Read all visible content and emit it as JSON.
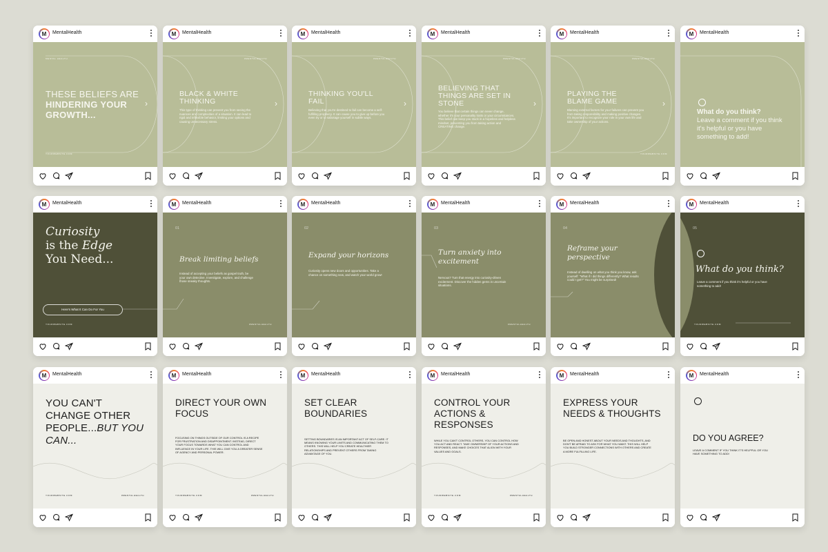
{
  "account": {
    "initial": "M",
    "handle": "MentalHealth"
  },
  "row1": [
    {
      "label": "MENTAL HEALTH",
      "title_a": "THESE BELIEFS ARE ",
      "title_b": "HINDERING YOUR GROWTH...",
      "footer": "YOURWEBSITE.COM"
    },
    {
      "label": "#MENTALHEALTH",
      "title": "BLACK & WHITE THINKING",
      "body": "This type of thinking can prevent you from seeing the nuances and complexities of a situation. It can lead to rigid and inflexible behavior, limiting your options and causing unnecessary stress."
    },
    {
      "label": "#MENTALHEALTH",
      "title": "THINKING YOU'LL FAIL",
      "body": "Believing that you're destined to fail can become a self-fulfilling prophecy. It can cause you to give up before you even try or to sabotage yourself in subtle ways."
    },
    {
      "label": "#MENTALHEALTH",
      "title": "BELIEVING THAT THINGS ARE SET IN STONE",
      "body": "You believe that certain things can never change, whether it's your personality traits or your circumstances. This belief can keep you stuck in a hopeless and helpless mindset, preventing you from taking action and CREATING change."
    },
    {
      "label": "#MENTALHEALTH",
      "title": "PLAYING THE BLAME GAME",
      "body": "Blaming external factors for your failures can prevent you from taking responsibility and making positive changes. It's important to recognize your role in your own life and take ownership of your actions.",
      "footer": "YOURWEBSITE.COM"
    },
    {
      "title": "What do you think?",
      "body": "Leave a comment if you think it's helpful or you have something to add!"
    }
  ],
  "row2": [
    {
      "title_a": "Curiosity",
      "title_b": "is the ",
      "title_c": "Edge",
      "title_d": "You Need...",
      "button": "Here's What It Can Do For You",
      "footer": "YOURWEBSITE.COM"
    },
    {
      "num": "01",
      "title": "Break limiting beliefs",
      "body": "Instead of accepting your beliefs as gospel truth, be your own detective. Investigate, explore, and challenge those sneaky thoughts.",
      "footer": "#MENTALHEALTH"
    },
    {
      "num": "02",
      "title": "Expand your horizons",
      "body": "Curiosity opens new doors and opportunities. Take a chance on something new, and watch your world grow!"
    },
    {
      "num": "03",
      "title": "Turn anxiety into excitement",
      "body": "Nervous? Turn that energy into curiosity-driven excitement. Discover the hidden gems in uncertain situations.",
      "footer": "#MENTALHEALTH"
    },
    {
      "num": "04",
      "title": "Reframe your perspective",
      "body": "Instead of dwelling on what you think you know, ask yourself: \"What if I did things differently? What results could I get?\" You might be surprised!"
    },
    {
      "num": "05",
      "title": "What do you think?",
      "body": "Leave a comment if you think it's helpful or you have something to add!",
      "footer": "YOURWEBSITE.COM"
    }
  ],
  "row3": [
    {
      "title_a": "YOU CAN'T CHANGE OTHER PEOPLE...",
      "title_b": "BUT YOU CAN...",
      "footer_l": "YOURWEBSITE.COM",
      "footer_r": "#MENTALHEALTH"
    },
    {
      "title": "DIRECT YOUR OWN FOCUS",
      "body": "FOCUSING ON THINGS OUTSIDE OF OUR CONTROL IS A RECIPE FOR FRUSTRATION AND DISAPPOINTMENT. INSTEAD, DIRECT YOUR FOCUS TOWARDS WHAT YOU CAN CONTROL AND INFLUENCE IN YOUR LIFE. THIS WILL GIVE YOU A GREATER SENSE OF AGENCY AND PERSONAL POWER.",
      "footer_l": "YOURWEBSITE.COM",
      "footer_r": "#MENTALHEALTH"
    },
    {
      "title": "SET CLEAR BOUNDARIES",
      "body": "SETTING BOUNDARIES IS AN IMPORTANT ACT OF SELF-CARE. IT MEANS KNOWING YOUR LIMITS AND COMMUNICATING THEM TO OTHERS. THIS WILL HELP YOU CREATE HEALTHIER RELATIONSHIPS AND PREVENT OTHERS FROM TAKING ADVANTAGE OF YOU."
    },
    {
      "title": "CONTROL YOUR ACTIONS & RESPONSES",
      "body": "WHILE YOU CAN'T CONTROL OTHERS, YOU CAN CONTROL HOW YOU ACT AND REACT. TAKE OWNERSHIP OF YOUR ACTIONS AND RESPONSES, AND MAKE CHOICES THAT ALIGN WITH YOUR VALUES AND GOALS.",
      "footer_l": "YOURWEBSITE.COM",
      "footer_r": "#MENTALHEALTH"
    },
    {
      "title": "EXPRESS YOUR NEEDS & THOUGHTS",
      "body": "BE OPEN AND HONEST ABOUT YOUR NEEDS AND THOUGHTS, AND DON'T BE AFRAID TO ASK FOR WHAT YOU WANT. THIS WILL HELP YOU BUILD STRONGER CONNECTIONS WITH OTHERS AND CREATE A MORE FULFILLING LIFE."
    },
    {
      "title": "DO YOU AGREE?",
      "body": "LEAVE A COMMENT IF YOU THINK IT'S HELPFUL OR YOU HAVE SOMETHING TO ADD!"
    }
  ]
}
